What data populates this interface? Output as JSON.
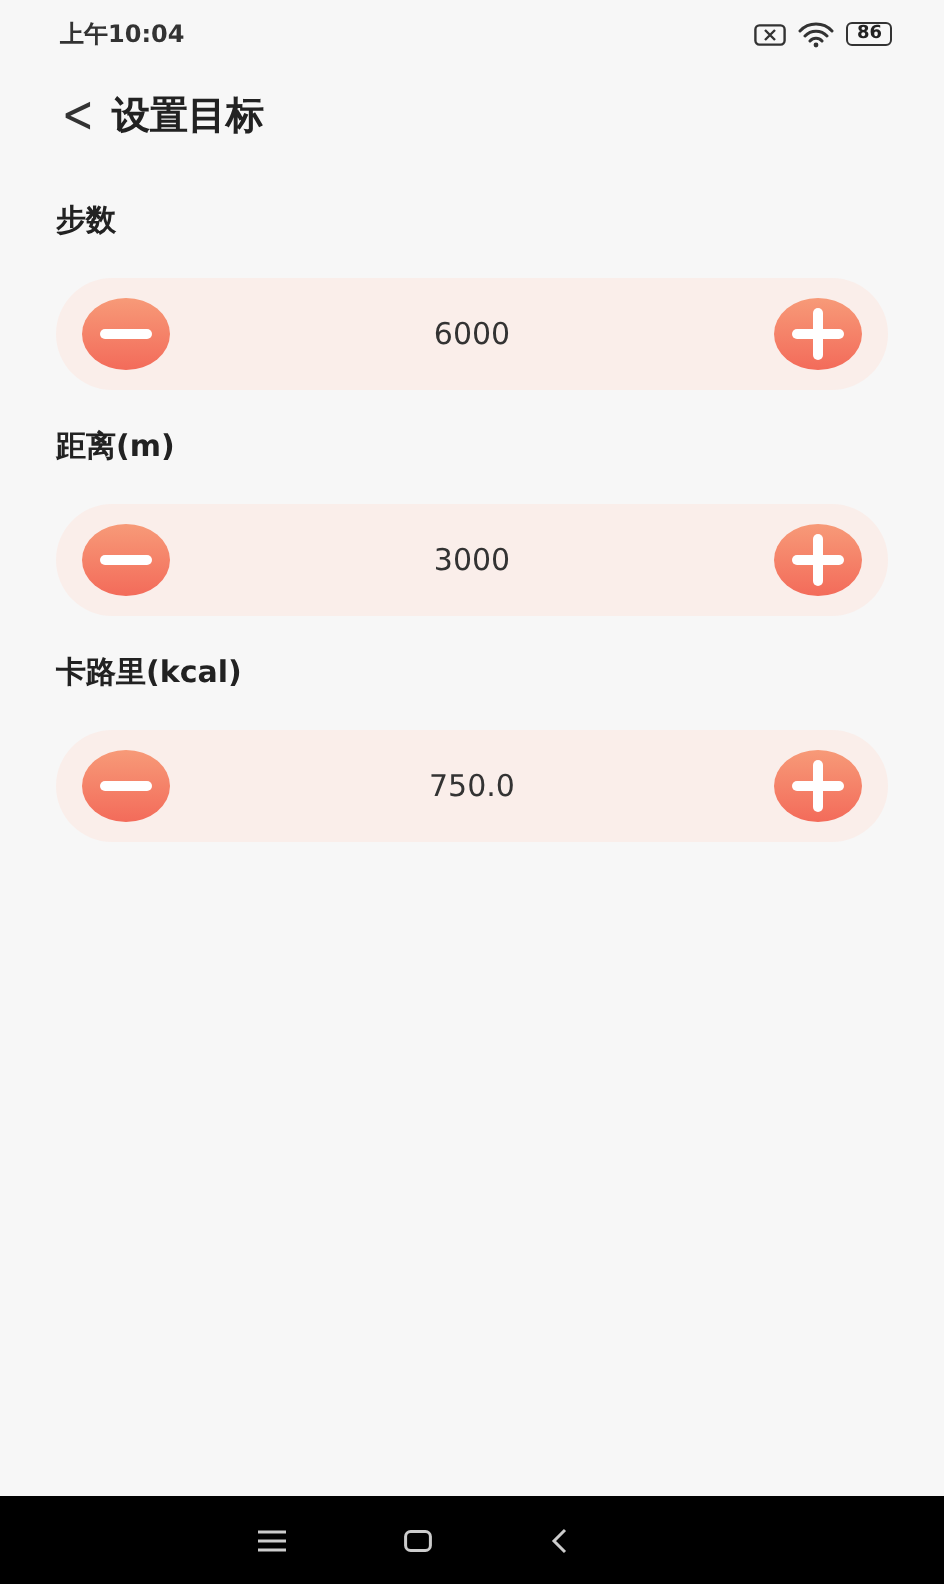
{
  "status_bar": {
    "time": "上午10:04",
    "battery": "86"
  },
  "header": {
    "back": "<",
    "title": "设置目标"
  },
  "goals": [
    {
      "label": "步数",
      "value": "6000"
    },
    {
      "label": "距离(m)",
      "value": "3000"
    },
    {
      "label": "卡路里(kcal)",
      "value": "750.0"
    }
  ]
}
